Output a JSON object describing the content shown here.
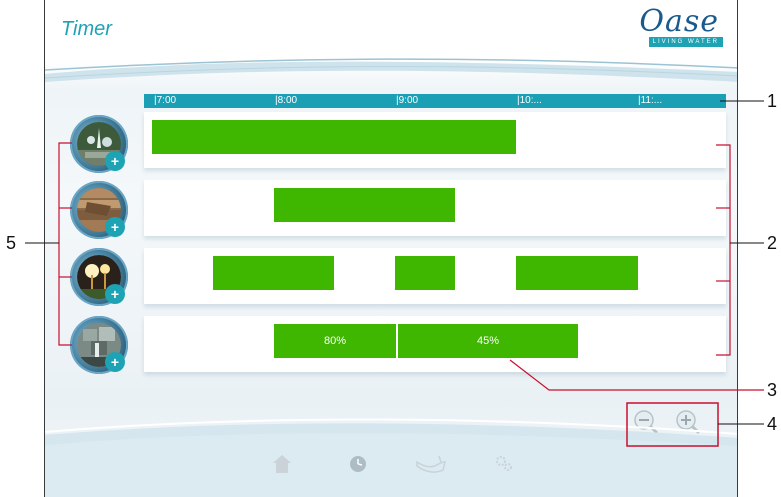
{
  "app": {
    "title": "Timer",
    "logo_text": "Oase",
    "logo_tagline": "LIVING WATER"
  },
  "timeline": {
    "ticks": [
      "|7:00",
      "|8:00",
      "|9:00",
      "|10:...",
      "|11:..."
    ]
  },
  "rows": [
    {
      "device": "fountain",
      "bars": [
        {
          "label": ""
        }
      ]
    },
    {
      "device": "stream",
      "bars": [
        {
          "label": ""
        }
      ]
    },
    {
      "device": "lights",
      "bars": [
        {
          "label": ""
        },
        {
          "label": ""
        },
        {
          "label": ""
        }
      ]
    },
    {
      "device": "waterfall",
      "bars": [
        {
          "label": "80%"
        },
        {
          "label": "45%"
        }
      ]
    }
  ],
  "callouts": {
    "c1": "1",
    "c2": "2",
    "c3": "3",
    "c4": "4",
    "c5": "5"
  },
  "icons": {
    "zoom_out": "zoom-out-icon",
    "zoom_in": "zoom-in-icon",
    "nav": [
      "home-icon",
      "clock-icon",
      "pond-icon",
      "settings-icon"
    ]
  },
  "colors": {
    "accent": "#1ea3b4",
    "bar": "#3fb600",
    "callout_line": "#c8102e",
    "logo": "#1a5a8c"
  }
}
